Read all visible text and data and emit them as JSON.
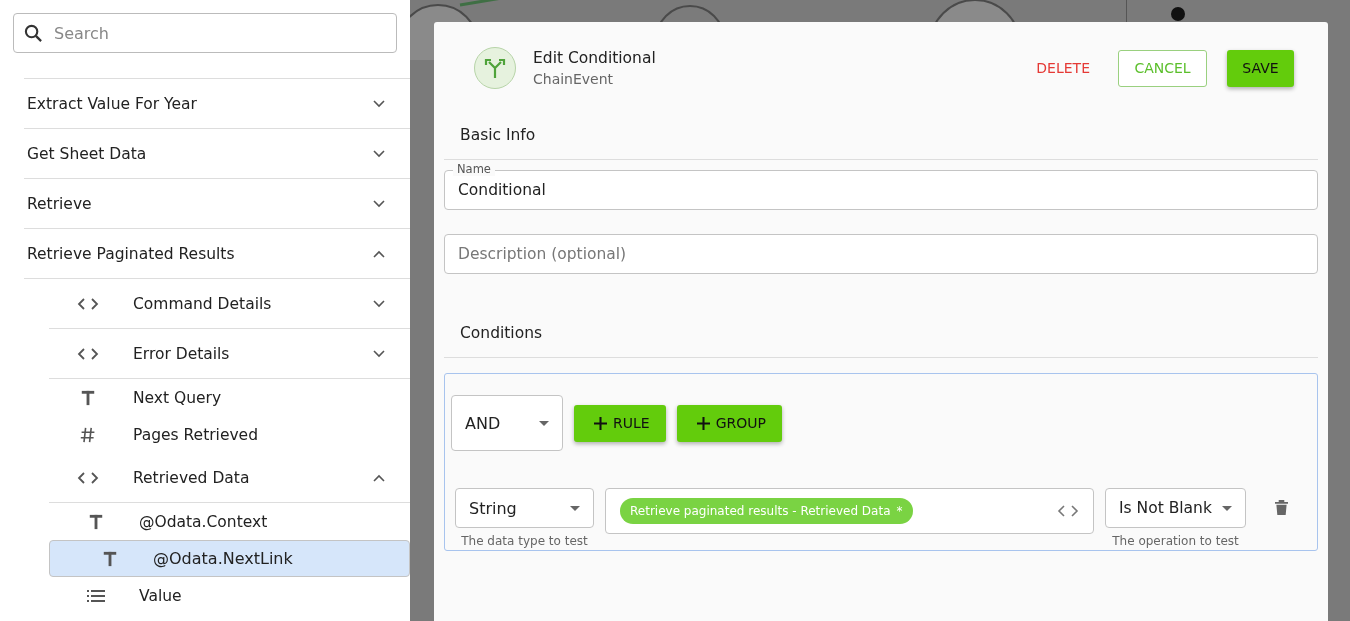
{
  "search": {
    "placeholder": "Search"
  },
  "tree": [
    {
      "label": "Extract Value For Year",
      "expanded": false,
      "selected": false
    },
    {
      "label": "Get Sheet Data",
      "expanded": false,
      "selected": false
    },
    {
      "label": "Retrieve",
      "expanded": false,
      "selected": false
    },
    {
      "label": "Retrieve Paginated Results",
      "expanded": true,
      "selected": false,
      "children": [
        {
          "label": "Command Details",
          "kind": "object",
          "expanded": false,
          "selected": false
        },
        {
          "label": "Error Details",
          "kind": "object",
          "expanded": false,
          "selected": false
        },
        {
          "label": "Next Query",
          "kind": "text",
          "selected": false
        },
        {
          "label": "Pages Retrieved",
          "kind": "number",
          "selected": false
        },
        {
          "label": "Retrieved Data",
          "kind": "object",
          "expanded": true,
          "selected": false,
          "children": [
            {
              "label": "@Odata.Context",
              "kind": "text",
              "selected": false
            },
            {
              "label": "@Odata.NextLink",
              "kind": "text",
              "selected": true
            },
            {
              "label": "Value",
              "kind": "list",
              "selected": false
            }
          ]
        }
      ]
    }
  ],
  "dialog": {
    "title": "Edit Conditional",
    "subtitle": "ChainEvent",
    "buttons": [
      {
        "label": "DELETE",
        "kind": "text"
      },
      {
        "label": "CANCEL",
        "kind": "outline"
      },
      {
        "label": "SAVE",
        "kind": "primary"
      }
    ],
    "basic_info": {
      "heading": "Basic Info",
      "name": {
        "label": "Name",
        "value": "Conditional"
      },
      "description": {
        "placeholder": "Description (optional)"
      }
    },
    "conditions": {
      "heading": "Conditions",
      "combinator": "AND",
      "add_buttons": [
        "RULE",
        "GROUP"
      ],
      "rule": {
        "data_type": "String",
        "data_type_hint": "The data type to test",
        "token": "Retrieve paginated results - Retrieved Data",
        "token_mark": "*",
        "operation": "Is Not Blank",
        "operation_hint": "The operation to test"
      }
    }
  }
}
